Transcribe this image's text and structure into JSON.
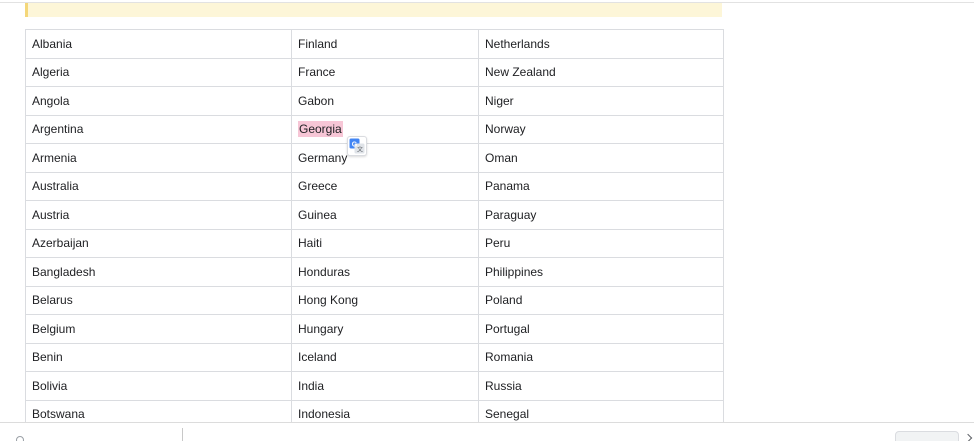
{
  "table": {
    "rows": [
      [
        "Albania",
        "Finland",
        "Netherlands"
      ],
      [
        "Algeria",
        "France",
        "New Zealand"
      ],
      [
        "Angola",
        "Gabon",
        "Niger"
      ],
      [
        "Argentina",
        "Georgia",
        "Norway"
      ],
      [
        "Armenia",
        "Germany",
        "Oman"
      ],
      [
        "Australia",
        "Greece",
        "Panama"
      ],
      [
        "Austria",
        "Guinea",
        "Paraguay"
      ],
      [
        "Azerbaijan",
        "Haiti",
        "Peru"
      ],
      [
        "Bangladesh",
        "Honduras",
        "Philippines"
      ],
      [
        "Belarus",
        "Hong Kong",
        "Poland"
      ],
      [
        "Belgium",
        "Hungary",
        "Portugal"
      ],
      [
        "Benin",
        "Iceland",
        "Romania"
      ],
      [
        "Bolivia",
        "India",
        "Russia"
      ],
      [
        "Botswana",
        "Indonesia",
        "Senegal"
      ]
    ],
    "highlighted_cell": {
      "row": 3,
      "col": 1
    }
  },
  "colors": {
    "highlight": "#f7c6d6",
    "notice_background": "#fdf6d8",
    "link": "#1a73e8",
    "border": "#dadce0"
  },
  "icons": {
    "translate_popup": "google-translate-icon"
  }
}
